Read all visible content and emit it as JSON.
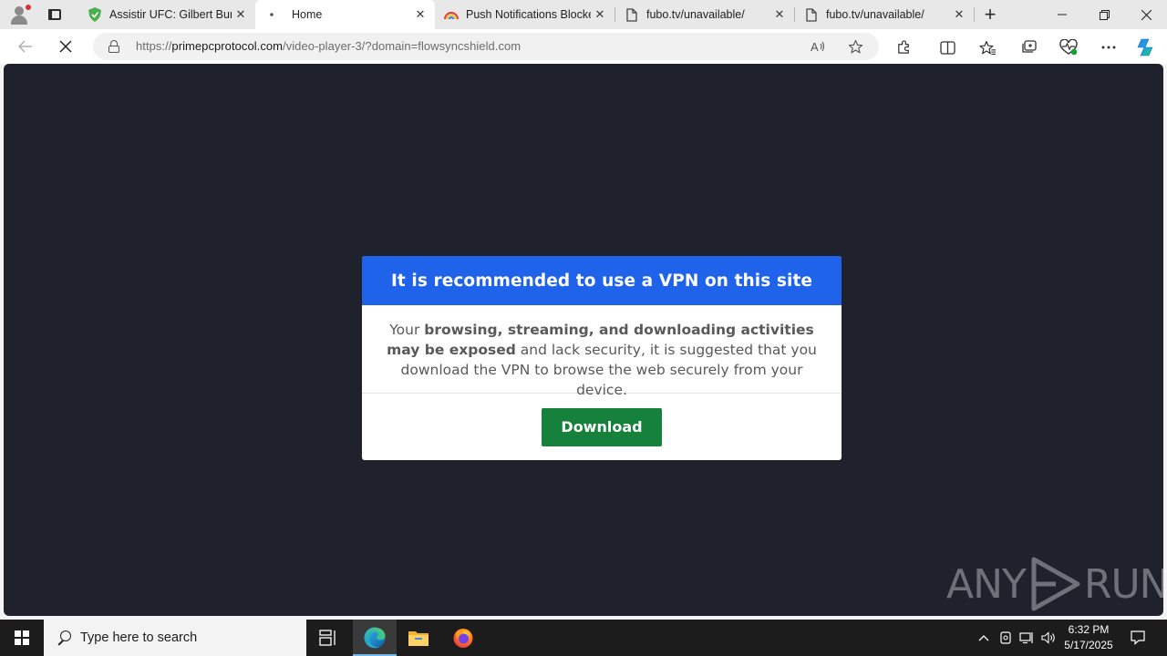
{
  "browser": {
    "tabs": [
      {
        "title": "Assistir UFC: Gilbert Burns",
        "favicon": "green-shield-icon",
        "active": false
      },
      {
        "title": "Home",
        "favicon": "loading-dot-icon",
        "active": true
      },
      {
        "title": "Push Notifications Blocker",
        "favicon": "rainbow-icon",
        "active": false
      },
      {
        "title": "fubo.tv/unavailable/",
        "favicon": "page-icon",
        "active": false
      },
      {
        "title": "fubo.tv/unavailable/",
        "favicon": "page-icon",
        "active": false
      }
    ],
    "address": {
      "scheme": "https://",
      "host": "primepcprotocol.com",
      "path": "/video-player-3/?domain=flowsyncshield.com"
    }
  },
  "page": {
    "modal": {
      "title": "It is recommended to use a VPN on this site",
      "body_prefix": "Your ",
      "body_bold_1": "browsing, streaming, and downloading activities may be exposed",
      "body_suffix": " and lack security, it is suggested that you download the VPN to browse the web securely from your device.",
      "button_label": "Download"
    },
    "watermark": {
      "left": "ANY",
      "right": "RUN"
    },
    "colors": {
      "background": "#1f222c",
      "header": "#1f63eb",
      "button": "#16813a"
    }
  },
  "taskbar": {
    "search_placeholder": "Type here to search",
    "time": "6:32 PM",
    "date": "5/17/2025"
  }
}
